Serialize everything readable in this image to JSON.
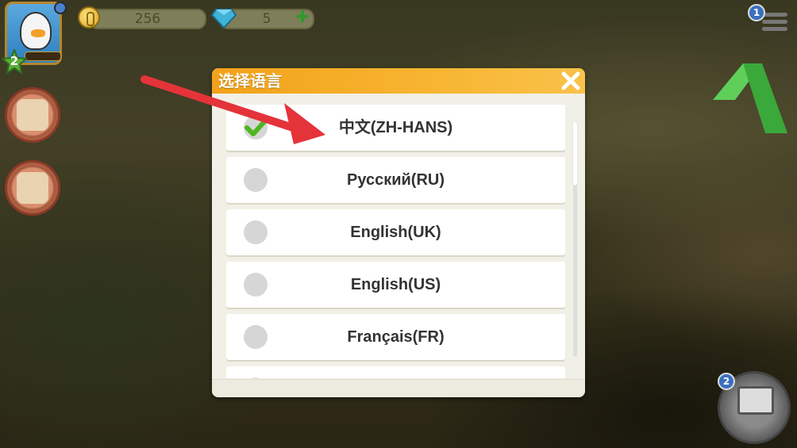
{
  "hud": {
    "level": "2",
    "coins": "256",
    "gems": "5",
    "menu_badge": "1",
    "register_badge": "2"
  },
  "dialog": {
    "title": "选择语言",
    "languages": [
      {
        "label": "中文(ZH-HANS)",
        "selected": true
      },
      {
        "label": "Русский(RU)",
        "selected": false
      },
      {
        "label": "English(UK)",
        "selected": false
      },
      {
        "label": "English(US)",
        "selected": false
      },
      {
        "label": "Français(FR)",
        "selected": false
      }
    ]
  },
  "colors": {
    "header_orange": "#f3a21a",
    "annotation_arrow": "#e5333a",
    "check_green": "#4cb61f"
  },
  "icons": [
    "close-icon",
    "checkmark-icon",
    "coin-icon",
    "gem-icon",
    "plus-icon",
    "menu-icon"
  ]
}
